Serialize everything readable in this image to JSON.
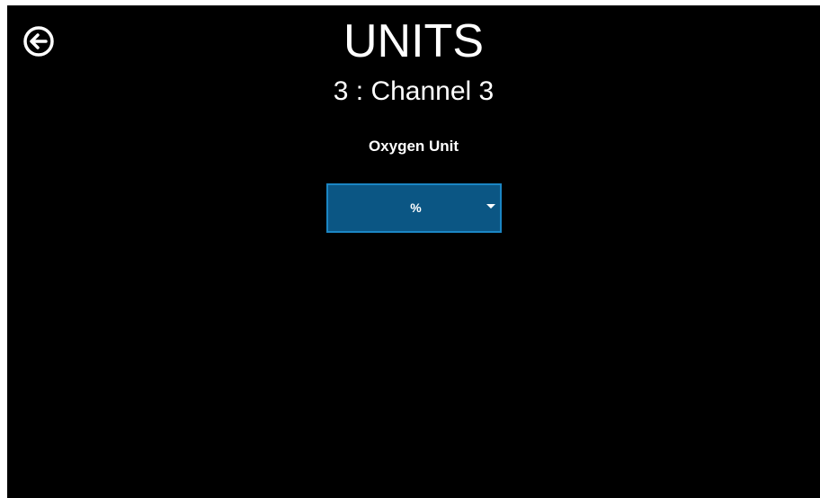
{
  "header": {
    "back_icon": "arrow-left-circle-icon",
    "title": "UNITS",
    "subtitle": "3 : Channel 3"
  },
  "form": {
    "label": "Oxygen Unit",
    "select": {
      "value": "%",
      "icon": "chevron-down-icon"
    }
  },
  "colors": {
    "background": "#000000",
    "text": "#ffffff",
    "select_fill": "#0b5684",
    "select_border": "#1b86c4"
  }
}
